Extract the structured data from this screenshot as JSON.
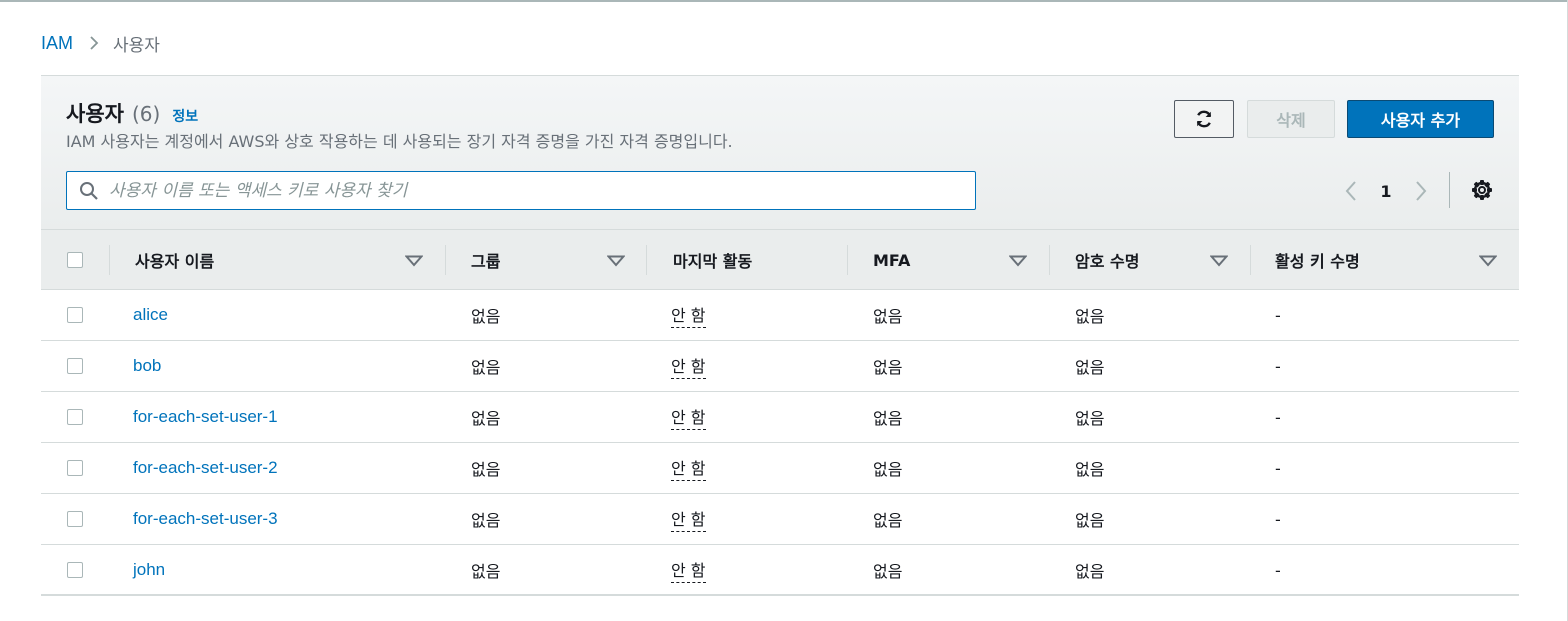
{
  "breadcrumb": {
    "root": "IAM",
    "current": "사용자"
  },
  "header": {
    "title": "사용자",
    "count": "(6)",
    "info": "정보",
    "description": "IAM 사용자는 계정에서 AWS와 상호 작용하는 데 사용되는 장기 자격 증명을 가진 자격 증명입니다."
  },
  "actions": {
    "delete_label": "삭제",
    "add_label": "사용자 추가"
  },
  "search": {
    "placeholder": "사용자 이름 또는 액세스 키로 사용자 찾기",
    "value": ""
  },
  "pagination": {
    "current_page": "1"
  },
  "columns": [
    "사용자 이름",
    "그룹",
    "마지막 활동",
    "MFA",
    "암호 수명",
    "활성 키 수명"
  ],
  "rows": [
    {
      "name": "alice",
      "group": "없음",
      "last_activity": "안 함",
      "mfa": "없음",
      "password_age": "없음",
      "active_key_age": "-"
    },
    {
      "name": "bob",
      "group": "없음",
      "last_activity": "안 함",
      "mfa": "없음",
      "password_age": "없음",
      "active_key_age": "-"
    },
    {
      "name": "for-each-set-user-1",
      "group": "없음",
      "last_activity": "안 함",
      "mfa": "없음",
      "password_age": "없음",
      "active_key_age": "-"
    },
    {
      "name": "for-each-set-user-2",
      "group": "없음",
      "last_activity": "안 함",
      "mfa": "없음",
      "password_age": "없음",
      "active_key_age": "-"
    },
    {
      "name": "for-each-set-user-3",
      "group": "없음",
      "last_activity": "안 함",
      "mfa": "없음",
      "password_age": "없음",
      "active_key_age": "-"
    },
    {
      "name": "john",
      "group": "없음",
      "last_activity": "안 함",
      "mfa": "없음",
      "password_age": "없음",
      "active_key_age": "-"
    }
  ],
  "icons": {
    "breadcrumb_separator": "chevron-right-icon",
    "refresh": "refresh-icon",
    "search": "search-icon",
    "prev": "chevron-left-icon",
    "next": "chevron-right-icon",
    "settings": "gear-icon",
    "sort": "caret-down-icon"
  },
  "colors": {
    "link": "#0073bb",
    "primary_button": "#0073bb",
    "text": "#16191f",
    "muted": "#687078"
  }
}
